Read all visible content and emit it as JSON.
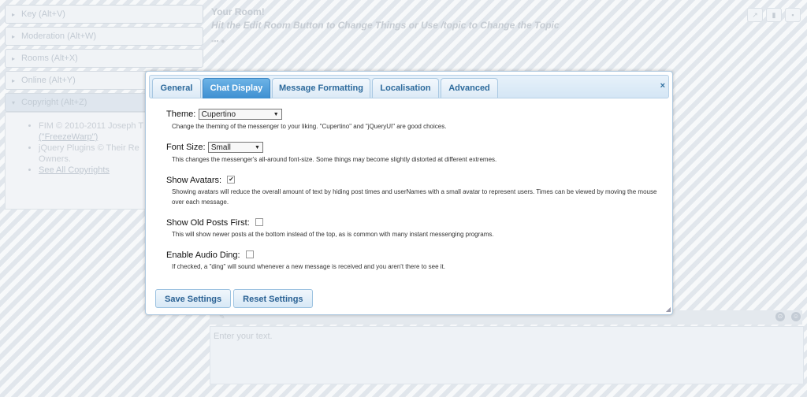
{
  "sidebar": {
    "items": [
      {
        "label": "Key (Alt+V)"
      },
      {
        "label": "Moderation (Alt+W)"
      },
      {
        "label": "Rooms (Alt+X)"
      },
      {
        "label": "Online (Alt+Y)"
      },
      {
        "label": "Copyright (Alt+Z)"
      }
    ],
    "copyright": {
      "fim": "FIM © 2010-2011 Joseph T",
      "fim2": "(\"FreezeWarp\")",
      "plugins": "jQuery Plugins © Their Re",
      "plugins2": "Owners.",
      "see_all": "See All Copyrights"
    }
  },
  "room": {
    "title": "Your Room!",
    "topic": "Hit the Edit Room Button to Change Things or Use /topic to Change the Topic"
  },
  "input": {
    "placeholder": "Enter your text."
  },
  "dialog": {
    "tabs": [
      {
        "label": "General"
      },
      {
        "label": "Chat Display"
      },
      {
        "label": "Message Formatting"
      },
      {
        "label": "Localisation"
      },
      {
        "label": "Advanced"
      }
    ],
    "active_tab": "Chat Display",
    "close_label": "×",
    "settings": {
      "theme": {
        "label": "Theme:",
        "value": "Cupertino",
        "desc": "Change the theming of the messenger to your liking. \"Cupertino\" and \"jQueryUI\" are good choices."
      },
      "font_size": {
        "label": "Font Size:",
        "value": "Small",
        "desc": "This changes the messenger's all-around font-size. Some things may become slightly distorted at different extremes."
      },
      "show_avatars": {
        "label": "Show Avatars:",
        "checked": true,
        "desc": "Showing avatars will reduce the overall amount of text by hiding post times and userNames with a small avatar to represent users. Times can be viewed by moving the mouse over each message."
      },
      "old_posts_first": {
        "label": "Show Old Posts First:",
        "checked": false,
        "desc": "This will show newer posts at the bottom instead of the top, as is common with many instant messenging programs."
      },
      "audio_ding": {
        "label": "Enable Audio Ding:",
        "checked": false,
        "desc": "If checked, a \"ding\" will sound whenever a new message is received and you aren't there to see it."
      }
    },
    "buttons": {
      "save": "Save Settings",
      "reset": "Reset Settings"
    }
  }
}
